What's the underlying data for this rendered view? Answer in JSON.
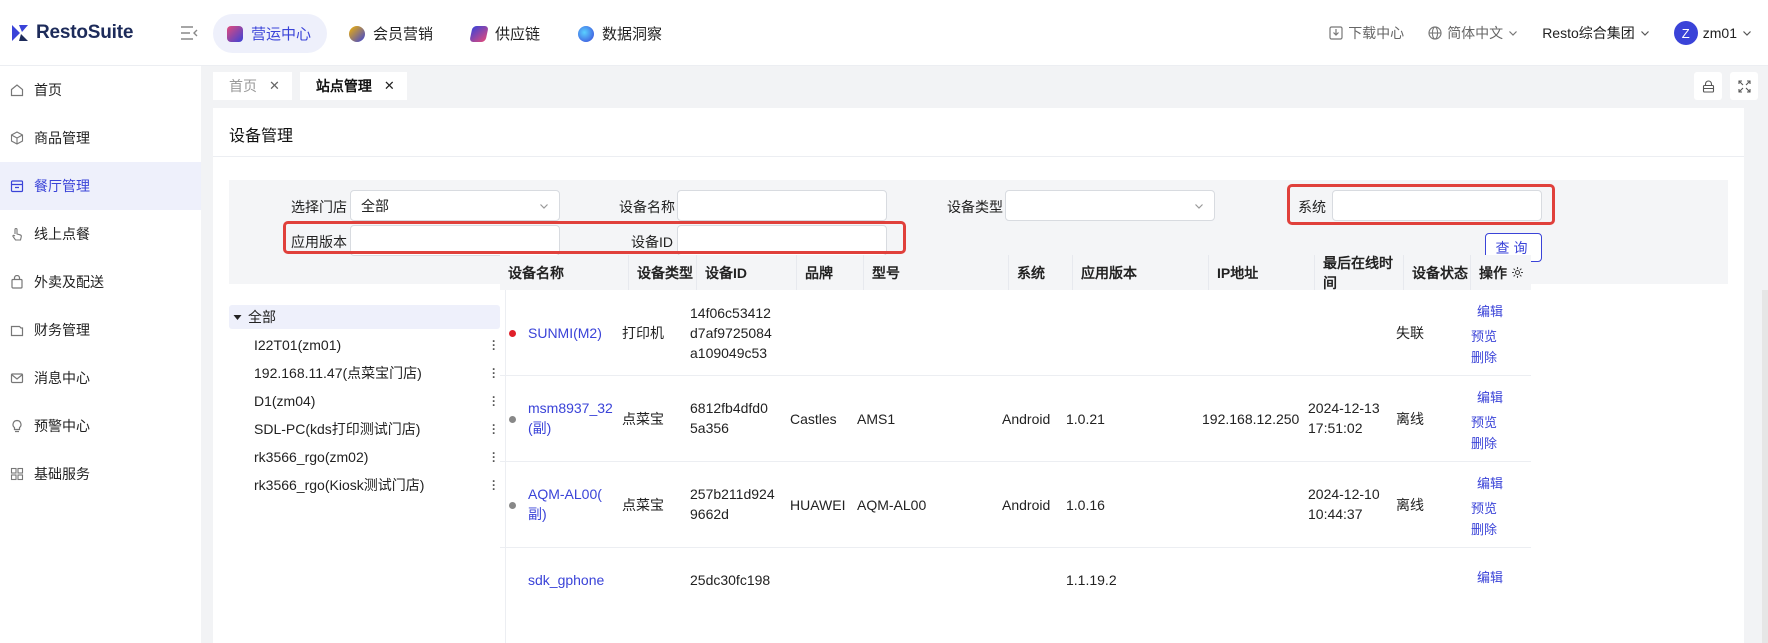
{
  "app": {
    "name": "RestoSuite",
    "brand_color": "#3a43d8"
  },
  "nav": {
    "items": [
      {
        "label": "营运中心",
        "icon": "ops-center-icon",
        "active": true
      },
      {
        "label": "会员营销",
        "icon": "member-marketing-icon"
      },
      {
        "label": "供应链",
        "icon": "supply-chain-icon"
      },
      {
        "label": "数据洞察",
        "icon": "data-insight-icon"
      }
    ]
  },
  "topright": {
    "download": "下载中心",
    "language": "简体中文",
    "org": "Resto综合集团",
    "avatar_letter": "Z",
    "user": "zm01"
  },
  "sidebar": {
    "items": [
      {
        "label": "首页",
        "icon": "home-icon"
      },
      {
        "label": "商品管理",
        "icon": "box-icon"
      },
      {
        "label": "餐厅管理",
        "icon": "store-icon",
        "active": true
      },
      {
        "label": "线上点餐",
        "icon": "hand-tap-icon"
      },
      {
        "label": "外卖及配送",
        "icon": "bag-icon"
      },
      {
        "label": "财务管理",
        "icon": "wallet-icon"
      },
      {
        "label": "消息中心",
        "icon": "mail-icon"
      },
      {
        "label": "预警中心",
        "icon": "bulb-icon"
      },
      {
        "label": "基础服务",
        "icon": "grid-icon"
      }
    ]
  },
  "tabs": [
    {
      "label": "首页",
      "active": false
    },
    {
      "label": "站点管理",
      "active": true
    }
  ],
  "page": {
    "title": "设备管理"
  },
  "filter": {
    "store_label": "选择门店",
    "store_value": "全部",
    "device_name_label": "设备名称",
    "device_type_label": "设备类型",
    "system_label": "系统",
    "app_version_label": "应用版本",
    "device_id_label": "设备ID",
    "query_label": "查询"
  },
  "tree": {
    "root": "全部",
    "nodes": [
      "I22T01(zm01)",
      "192.168.11.47(点菜宝门店)",
      "D1(zm04)",
      "SDL-PC(kds打印测试门店)",
      "rk3566_rgo(zm02)",
      "rk3566_rgo(Kiosk测试门店)"
    ]
  },
  "table": {
    "columns": [
      "设备名称",
      "设备类型",
      "设备ID",
      "品牌",
      "型号",
      "系统",
      "应用版本",
      "IP地址",
      "最后在线时间",
      "设备状态",
      "操作"
    ],
    "rows": [
      {
        "status_color": "#e0202a",
        "name": "SUNMI(M2)",
        "type": "打印机",
        "device_id_lines": [
          "14f06c53412",
          "d7af9725084",
          "a109049c53"
        ],
        "brand": "",
        "model": "",
        "system": "",
        "version": "",
        "ip": "",
        "last_online_lines": [
          "",
          ""
        ],
        "status": "失联",
        "ops": [
          "编辑",
          "预览",
          "删除"
        ]
      },
      {
        "status_color": "#888888",
        "name": "msm8937_32",
        "name2": "(副)",
        "type": "点菜宝",
        "device_id_lines": [
          "6812fb4dfd0",
          "5a356"
        ],
        "brand": "Castles",
        "model": "AMS1",
        "system": "Android",
        "version": "1.0.21",
        "ip": "192.168.12.250",
        "last_online_lines": [
          "2024-12-13",
          "17:51:02"
        ],
        "status": "离线",
        "ops": [
          "编辑",
          "预览",
          "删除"
        ]
      },
      {
        "status_color": "#888888",
        "name": "AQM-AL00(",
        "name2": "副)",
        "type": "点菜宝",
        "device_id_lines": [
          "257b211d924",
          "9662d"
        ],
        "brand": "HUAWEI",
        "model": "AQM-AL00",
        "system": "Android",
        "version": "1.0.16",
        "ip": "",
        "last_online_lines": [
          "2024-12-10",
          "10:44:37"
        ],
        "status": "离线",
        "ops": [
          "编辑",
          "预览",
          "删除"
        ]
      },
      {
        "name": "sdk_gphone",
        "device_id": "25dc30fc198",
        "version": "1.1.19.2",
        "ops": [
          "编辑"
        ]
      }
    ]
  }
}
